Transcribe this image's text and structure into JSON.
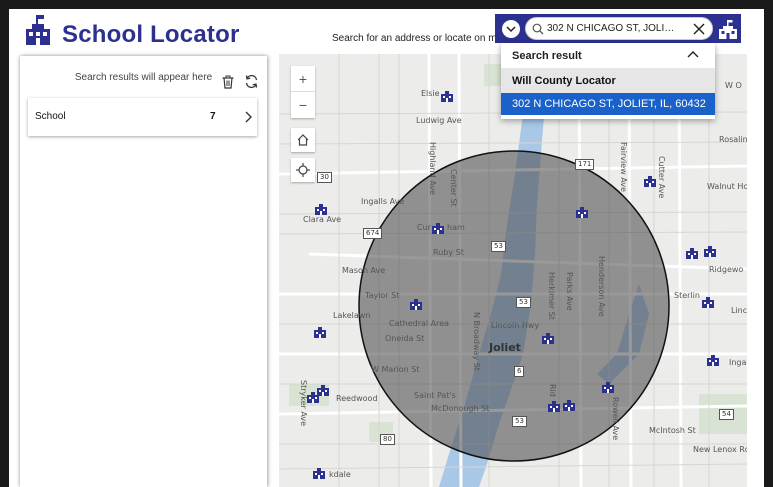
{
  "header": {
    "title": "School Locator",
    "search_hint": "Search for an address or locate on map"
  },
  "search": {
    "value": "302 N CHICAGO ST, JOLIE...",
    "dropdown_title": "Search result",
    "group_label": "Will County Locator",
    "selected_result": "302 N CHICAGO ST, JOLIET, IL, 60432"
  },
  "sidebar": {
    "hint": "Search results will appear here",
    "results": [
      {
        "label": "School",
        "count": "7"
      }
    ]
  },
  "map": {
    "zoom_in": "+",
    "zoom_out": "−",
    "labels": {
      "elsie": "Elsie",
      "ludwig": "Ludwig Ave",
      "ingalls": "Ingalls Ave",
      "clara": "Clara Ave",
      "curtis": "Cur",
      "curtis_b": "ham",
      "ruby": "Ruby St",
      "mason": "Mason Ave",
      "taylor": "Taylor St",
      "lakelawn": "Lakelawn",
      "cathedral": "Cathedral Area",
      "oneida": "Oneida St",
      "lincoln": "Lincoln Hwy",
      "joliet": "Joliet",
      "wmarion": "W Marion St",
      "reedwood": "Reedwood",
      "saintpats": "Saint Pat's",
      "mcdonough": "McDonough St",
      "kdale": "kdale",
      "walnut": "Walnut Hol",
      "ridgewood": "Ridgewo",
      "sterling": "Sterlin",
      "inga": "Inga",
      "rosaline": "Rosalin",
      "mcintosh": "McIntosh St",
      "newlenox": "New Lenox Rd",
      "highland": "Highland Ave",
      "center": "Center St",
      "broadway": "N Broadway St",
      "herkimer": "Herkimer St",
      "parks": "Parks Ave",
      "henderson": "Henderson Ave",
      "fairview": "Fairview Ave",
      "cutter": "Cutter Ave",
      "stryker": "Stryker Ave",
      "rid": "Rid",
      "rowell": "Rowell Ave",
      "line": "Linc",
      "wo": "W O"
    },
    "shields": {
      "r30": "30",
      "r53a": "53",
      "r53b": "53",
      "r53c": "53",
      "r6": "6",
      "r80": "80",
      "r54": "54",
      "r171": "171",
      "r674": "674"
    }
  },
  "colors": {
    "brand": "#2c3190",
    "selected": "#1a62c9",
    "buffer": "rgba(70,70,70,0.55)"
  }
}
